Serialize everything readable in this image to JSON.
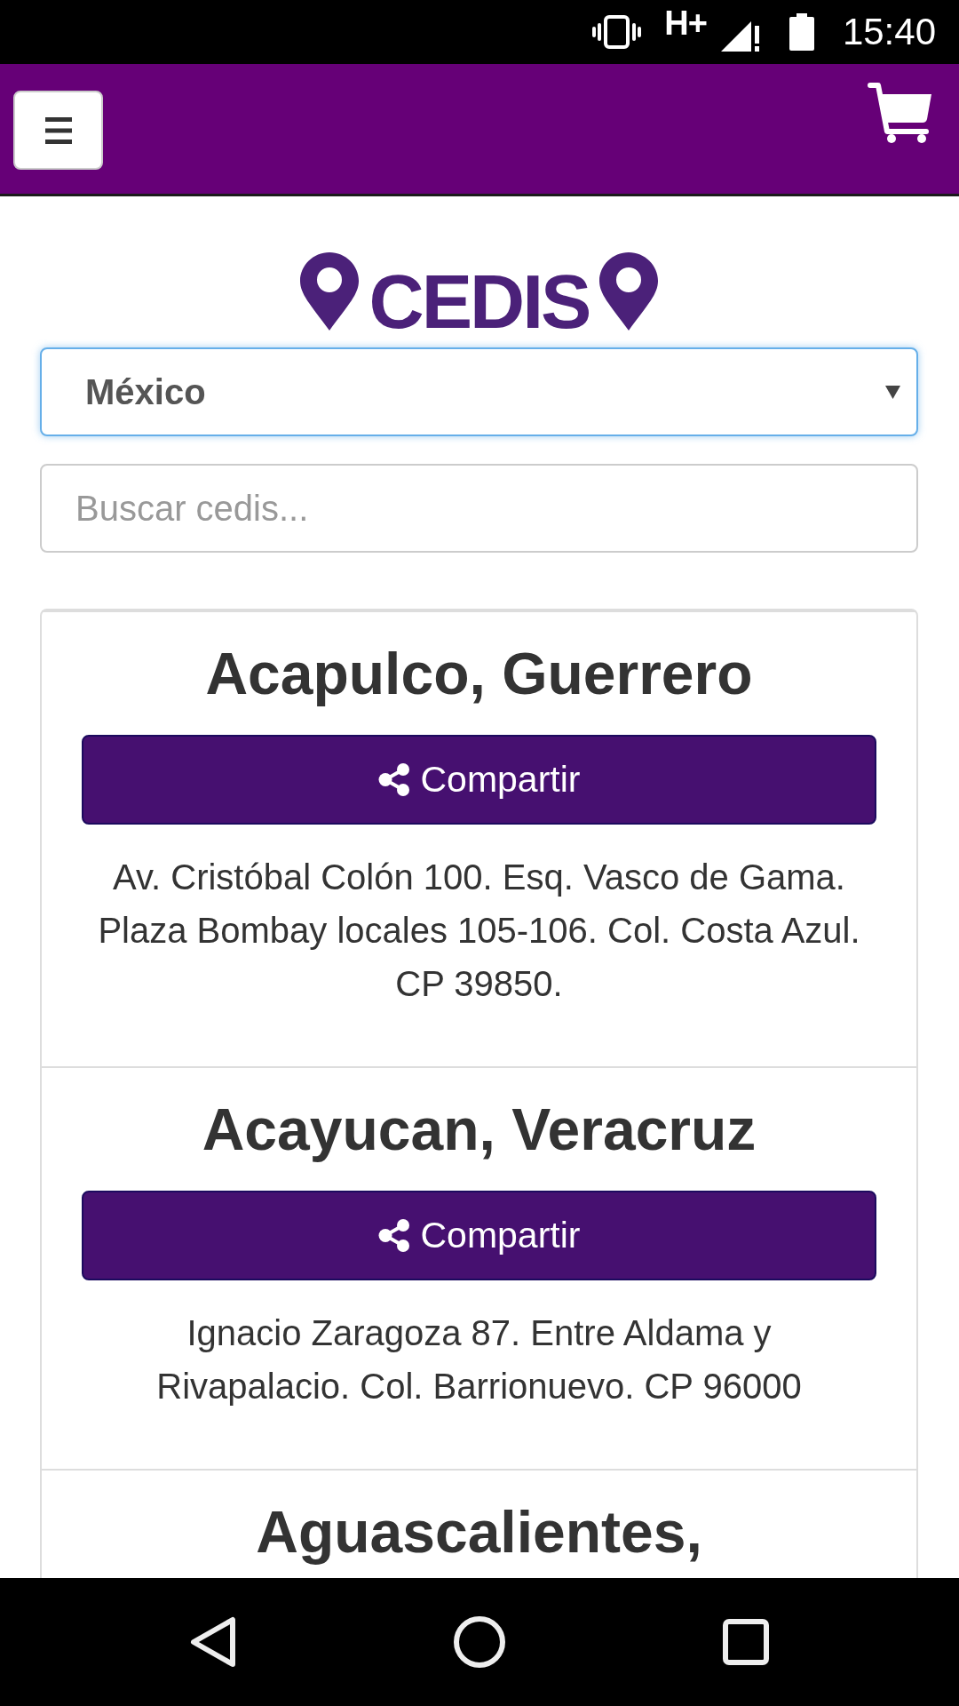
{
  "status_bar": {
    "network": "H+",
    "time": "15:40"
  },
  "page_title": "CEDIS",
  "country_select": {
    "value": "México",
    "focused": true
  },
  "search": {
    "placeholder": "Buscar cedis..."
  },
  "locations": [
    {
      "name": "Acapulco, Guerrero",
      "share_button": "Compartir",
      "address": "Av. Cristóbal Colón 100. Esq. Vasco de Gama. Plaza Bombay locales 105-106. Col. Costa Azul. CP 39850."
    },
    {
      "name": "Acayucan, Veracruz",
      "share_button": "Compartir",
      "address": "Ignacio Zaragoza 87. Entre Aldama y Rivapalacio. Col. Barrionuevo. CP 96000"
    },
    {
      "name": "Aguascalientes,"
    }
  ]
}
